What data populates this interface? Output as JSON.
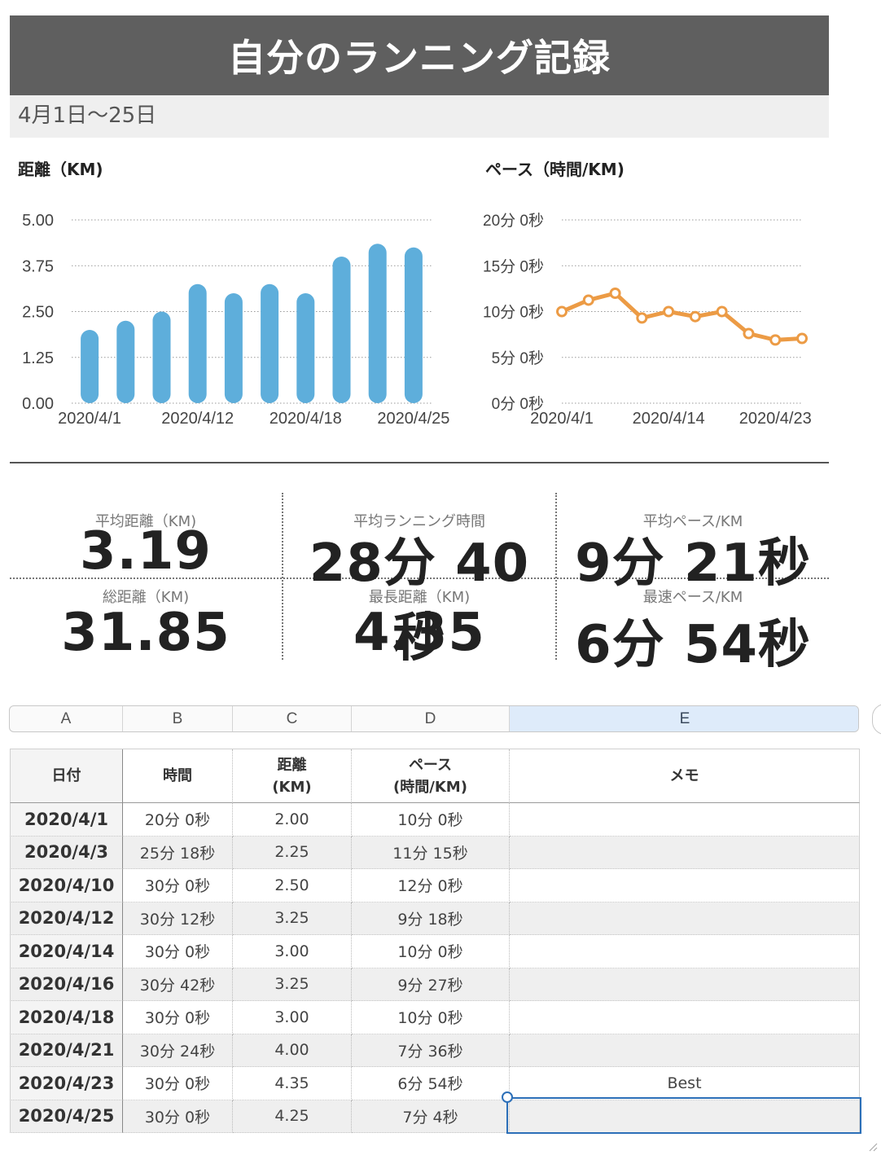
{
  "header": {
    "title": "自分のランニング記録",
    "subtitle": "4月1日〜25日"
  },
  "charts": {
    "distance_title": "距離（KM)",
    "pace_title": "ペース（時間/KM)"
  },
  "chart_data": [
    {
      "type": "bar",
      "title": "距離（KM)",
      "x": [
        "2020/4/1",
        "2020/4/3",
        "2020/4/10",
        "2020/4/12",
        "2020/4/14",
        "2020/4/16",
        "2020/4/18",
        "2020/4/21",
        "2020/4/23",
        "2020/4/25"
      ],
      "values": [
        2.0,
        2.25,
        2.5,
        3.25,
        3.0,
        3.25,
        3.0,
        4.0,
        4.35,
        4.25
      ],
      "ylim": [
        0,
        5
      ],
      "yticks": [
        "0.00",
        "1.25",
        "2.50",
        "3.75",
        "5.00"
      ],
      "xtick_labels": [
        "2020/4/1",
        "2020/4/12",
        "2020/4/18",
        "2020/4/25"
      ],
      "xtick_indices": [
        0,
        3,
        6,
        9
      ],
      "color": "#5eaedb",
      "grid": true
    },
    {
      "type": "line",
      "title": "ペース（時間/KM)",
      "x": [
        "2020/4/1",
        "2020/4/3",
        "2020/4/10",
        "2020/4/12",
        "2020/4/14",
        "2020/4/16",
        "2020/4/18",
        "2020/4/21",
        "2020/4/23",
        "2020/4/25"
      ],
      "values_seconds": [
        600,
        675,
        720,
        558,
        600,
        567,
        600,
        456,
        414,
        424
      ],
      "ylim_seconds": [
        0,
        1200
      ],
      "yticks": [
        "0分 0秒",
        "5分 0秒",
        "10分 0秒",
        "15分 0秒",
        "20分 0秒"
      ],
      "xtick_labels": [
        "2020/4/1",
        "2020/4/14",
        "2020/4/23"
      ],
      "xtick_indices": [
        0,
        4,
        8
      ],
      "color": "#ec9b45",
      "grid": true
    }
  ],
  "stats": {
    "avg_distance_label": "平均距離（KM)",
    "avg_distance_value": "3.19",
    "avg_time_label": "平均ランニング時間",
    "avg_time_value": "28分 40秒",
    "avg_pace_label": "平均ペース/KM",
    "avg_pace_value": "9分 21秒",
    "total_distance_label": "総距離（KM)",
    "total_distance_value": "31.85",
    "max_distance_label": "最長距離（KM)",
    "max_distance_value": "4.35",
    "best_pace_label": "最速ペース/KM",
    "best_pace_value": "6分 54秒"
  },
  "spreadsheet": {
    "columns": [
      "A",
      "B",
      "C",
      "D",
      "E"
    ],
    "selected_column": "E",
    "headers": {
      "date": "日付",
      "time": "時間",
      "dist_1": "距離",
      "dist_2": "(KM)",
      "pace_1": "ペース",
      "pace_2": "(時間/KM)",
      "memo": "メモ"
    },
    "rows": [
      {
        "date": "2020/4/1",
        "time": "20分 0秒",
        "dist": "2.00",
        "pace": "10分 0秒",
        "memo": ""
      },
      {
        "date": "2020/4/3",
        "time": "25分 18秒",
        "dist": "2.25",
        "pace": "11分 15秒",
        "memo": ""
      },
      {
        "date": "2020/4/10",
        "time": "30分 0秒",
        "dist": "2.50",
        "pace": "12分 0秒",
        "memo": ""
      },
      {
        "date": "2020/4/12",
        "time": "30分 12秒",
        "dist": "3.25",
        "pace": "9分 18秒",
        "memo": ""
      },
      {
        "date": "2020/4/14",
        "time": "30分 0秒",
        "dist": "3.00",
        "pace": "10分 0秒",
        "memo": ""
      },
      {
        "date": "2020/4/16",
        "time": "30分 42秒",
        "dist": "3.25",
        "pace": "9分 27秒",
        "memo": ""
      },
      {
        "date": "2020/4/18",
        "time": "30分 0秒",
        "dist": "3.00",
        "pace": "10分 0秒",
        "memo": ""
      },
      {
        "date": "2020/4/21",
        "time": "30分 24秒",
        "dist": "4.00",
        "pace": "7分 36秒",
        "memo": ""
      },
      {
        "date": "2020/4/23",
        "time": "30分 0秒",
        "dist": "4.35",
        "pace": "6分 54秒",
        "memo": "Best"
      },
      {
        "date": "2020/4/25",
        "time": "30分 0秒",
        "dist": "4.25",
        "pace": "7分 4秒",
        "memo": ""
      }
    ]
  }
}
